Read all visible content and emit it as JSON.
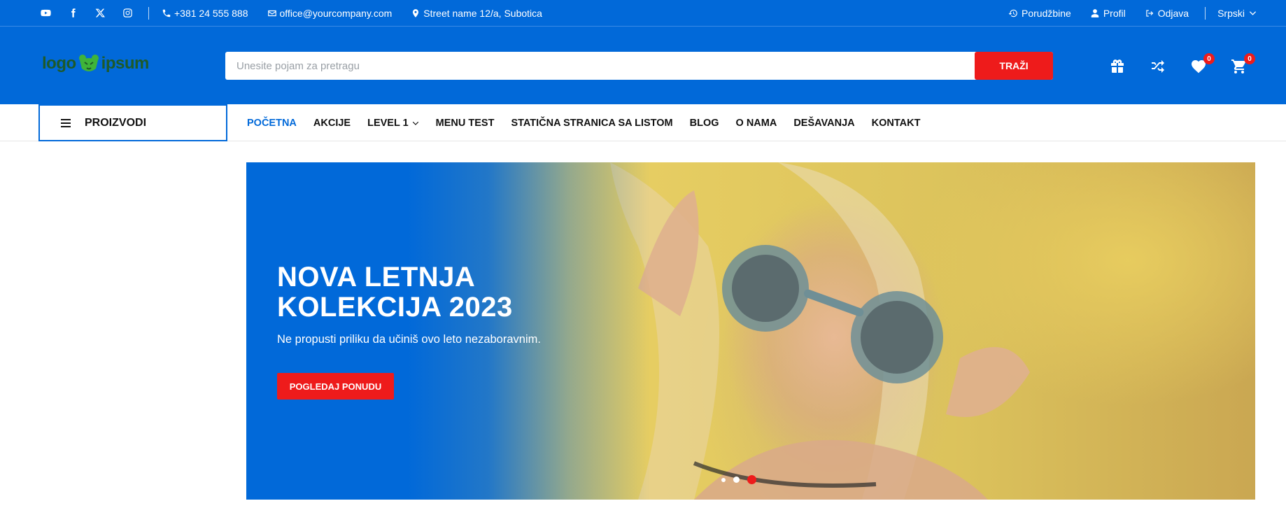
{
  "topbar": {
    "social": [
      {
        "icon": "youtube-icon"
      },
      {
        "icon": "facebook-icon"
      },
      {
        "icon": "x-twitter-icon"
      },
      {
        "icon": "instagram-icon"
      }
    ],
    "phone": "+381 24 555 888",
    "email": "office@yourcompany.com",
    "address": "Street name 12/a, Subotica",
    "orders_label": "Porudžbine",
    "profile_label": "Profil",
    "logout_label": "Odjava",
    "language": "Srpski"
  },
  "header": {
    "logo_left": "logo",
    "logo_right": "ipsum",
    "search_placeholder": "Unesite pojam za pretragu",
    "search_button": "TRAŽI",
    "wishlist_count": "0",
    "cart_count": "0"
  },
  "nav": {
    "categories_label": "PROIZVODI",
    "items": [
      {
        "label": "POČETNA",
        "active": true
      },
      {
        "label": "AKCIJE"
      },
      {
        "label": "LEVEL 1",
        "dropdown": true
      },
      {
        "label": "MENU TEST"
      },
      {
        "label": "STATIČNA STRANICA SA LISTOM"
      },
      {
        "label": "BLOG"
      },
      {
        "label": "O NAMA"
      },
      {
        "label": "DEŠAVANJA"
      },
      {
        "label": "KONTAKT"
      }
    ]
  },
  "hero": {
    "title_line1": "NOVA LETNJA",
    "title_line2": "KOLEKCIJA 2023",
    "subtitle": "Ne propusti priliku da učiniš ovo leto nezaboravnim.",
    "button": "POGLEDAJ PONUDU",
    "slides_total": 3,
    "active_slide": 3
  },
  "colors": {
    "primary": "#0169d9",
    "accent": "#ee1b1b",
    "logo": "#1d5a2a",
    "logo_icon": "#3fb43a"
  }
}
